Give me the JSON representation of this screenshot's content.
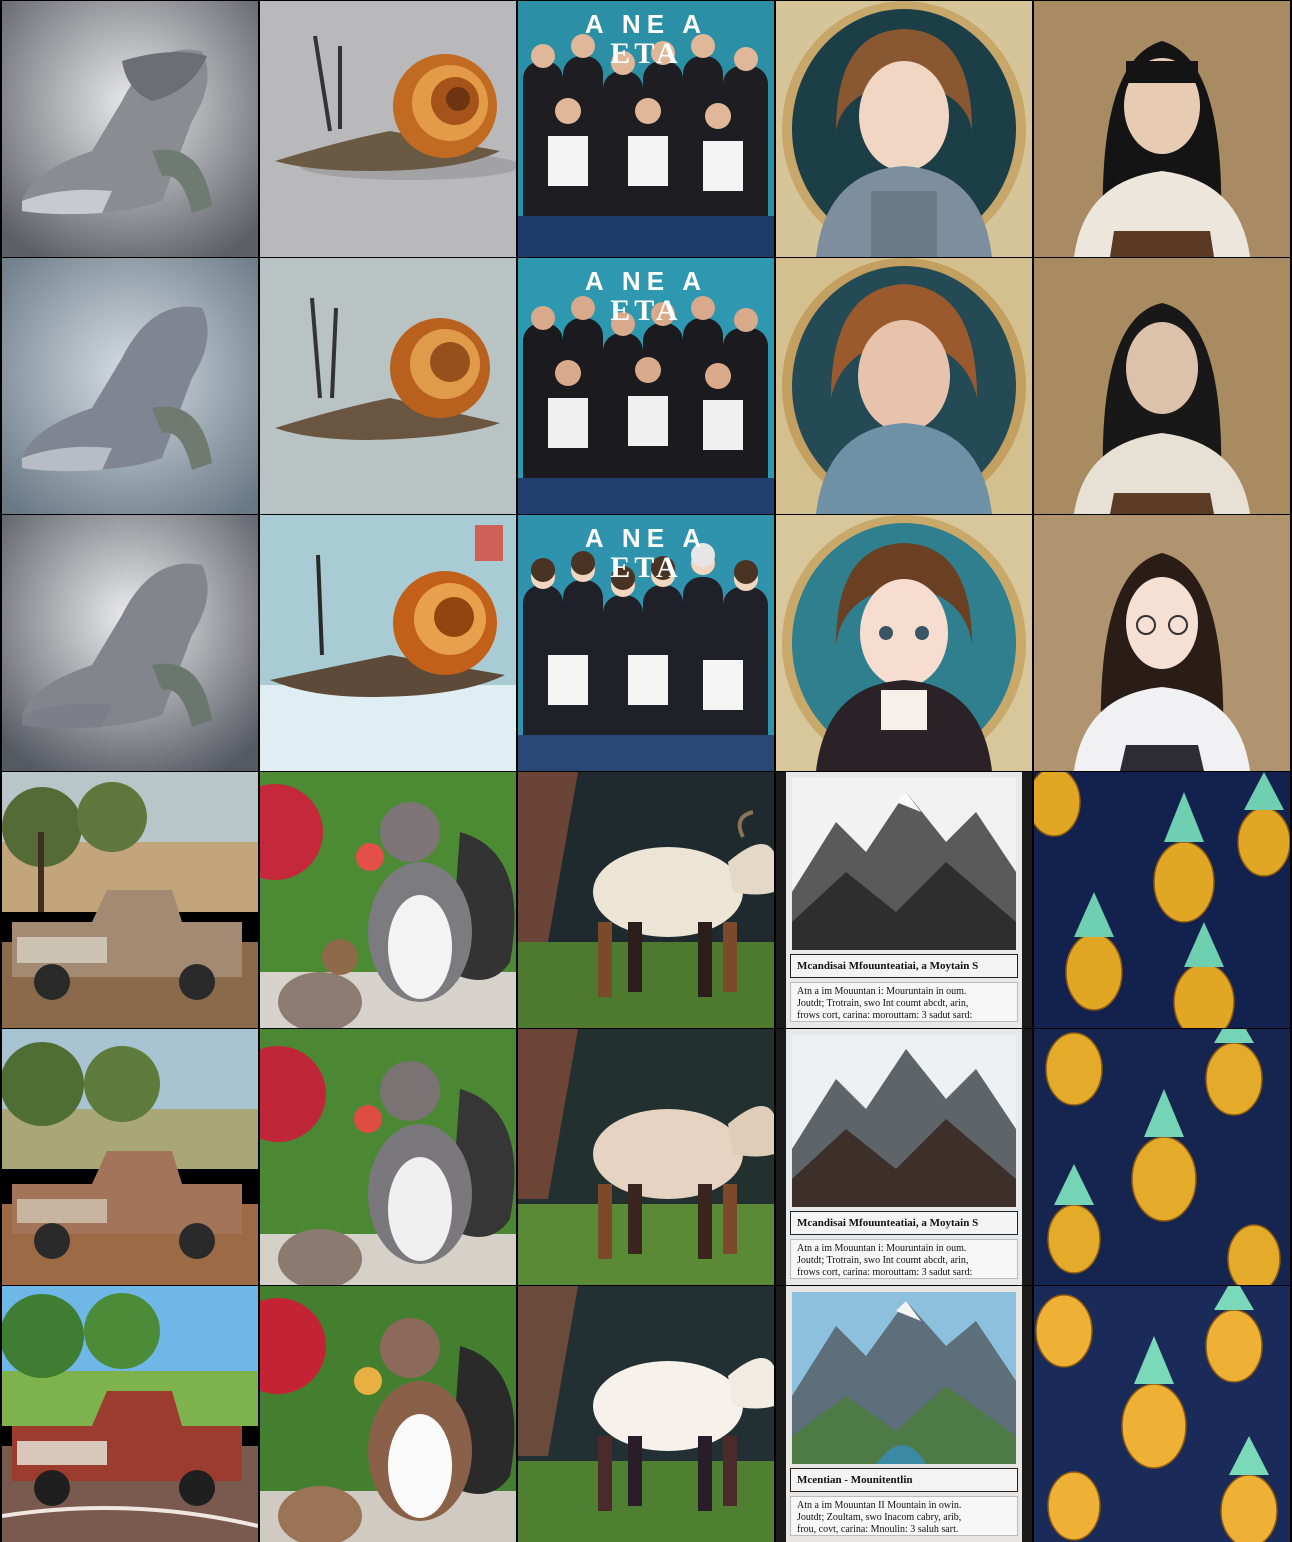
{
  "rows": [
    {
      "subjects": [
        "sock-heel-shoe",
        "snail",
        "group-photo",
        "girl-portrait-oval",
        "girl-portrait-plain"
      ],
      "poster": {
        "line1": "A NE A",
        "line2": "ETA"
      }
    },
    {
      "subjects": [
        "pickup-truck",
        "squirrels-with-apple",
        "goat",
        "mountain-card",
        "pineapple-pattern"
      ],
      "cards": [
        {
          "title": "Mcandisai Mfouunteatiai, a Moytain S",
          "body": "Atn a im Mouuntan i: Mouruntain in oum.\nJoutdt; Trotrain, swo Int coumt abcdt, arin,\nfrows cort, carina: morouttam: 3 sadut sard:"
        },
        {
          "title": "Mcandisai Mfouunteatiai, a Moytain S",
          "body": "Atn a im Mouuntan i: Mouruntain in oum.\nJoutdt; Trotrain, swo Int coumt abcdt, arin,\nfrows cort, carina: morouttam: 3 sadut sard:"
        },
        {
          "title": "Mcentian - Mounitentlin",
          "body": "Atn a im Mouuntan II Mountain in owin.\nJoutdt; Zoultam, swo Inacom cabry, arib,\nfrou, covt, carina: Mnoulin: 3 saluh sart."
        }
      ]
    }
  ],
  "colors": {
    "background": "#000000",
    "teal": "#2b8fa6",
    "pineapple_bg": "#13214f",
    "grass": "#4d8a34"
  }
}
